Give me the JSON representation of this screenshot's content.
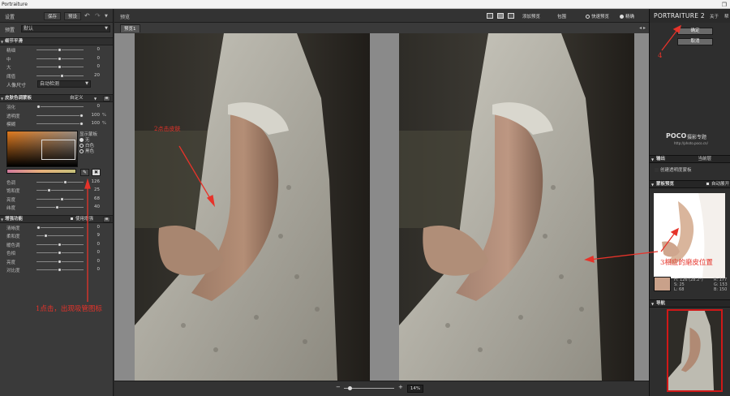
{
  "window": {
    "title": "Portraiture",
    "maximize_icon": "restore-icon"
  },
  "left_panel": {
    "header": {
      "settings": "设置",
      "save": "保存",
      "preset": "预设"
    },
    "preset_row": {
      "label": "预置",
      "value": "默认"
    },
    "detail": {
      "title": "细节平滑",
      "sliders": [
        {
          "label": "精细",
          "value": "0",
          "pos": 0.5
        },
        {
          "label": "中",
          "value": "0",
          "pos": 0.5
        },
        {
          "label": "大",
          "value": "0",
          "pos": 0.5
        },
        {
          "label": "阈值",
          "value": "20",
          "pos": 0.55
        }
      ],
      "portrait_size": {
        "label": "人像尺寸",
        "value": "自动检测"
      }
    },
    "skin_mask": {
      "title": "皮肤色调蒙板",
      "mode": "自定义",
      "sliders": [
        {
          "label": "羽化",
          "value": "0",
          "unit": "",
          "pos": 0.05
        },
        {
          "label": "透明度",
          "value": "100",
          "unit": "%",
          "pos": 0.97
        },
        {
          "label": "模糊",
          "value": "100",
          "unit": "%",
          "pos": 0.97
        }
      ],
      "mask_options": {
        "label": "显示蒙板",
        "options": [
          "无",
          "白色",
          "黑色"
        ],
        "selected": 0
      },
      "color_sliders": [
        {
          "label": "色调",
          "value": "126",
          "pos": 0.62
        },
        {
          "label": "饱和度",
          "value": "25",
          "pos": 0.28
        },
        {
          "label": "亮度",
          "value": "68",
          "pos": 0.55
        },
        {
          "label": "纬度",
          "value": "40",
          "pos": 0.45
        }
      ]
    },
    "enhance": {
      "title": "增强功能",
      "use_enhance": "使用增强",
      "sliders": [
        {
          "label": "清晰度",
          "value": "0",
          "pos": 0.05
        },
        {
          "label": "柔和度",
          "value": "9",
          "pos": 0.2
        },
        {
          "label": "暖色调",
          "value": "0",
          "pos": 0.5
        },
        {
          "label": "色相",
          "value": "0",
          "pos": 0.5
        },
        {
          "label": "亮度",
          "value": "0",
          "pos": 0.5
        },
        {
          "label": "对比度",
          "value": "0",
          "pos": 0.5
        }
      ]
    }
  },
  "center": {
    "title": "预览",
    "toolbar": {
      "add_preview": "添加预览",
      "compare": "包围",
      "quick_preview": "快速预览",
      "fine": "精确"
    },
    "tab": "预览1",
    "zoom": "14%"
  },
  "right_panel": {
    "brand": "PORTRAITURE 2",
    "about": "关于",
    "help": "帮",
    "ok": "确定",
    "cancel": "取消",
    "poco": {
      "name": "POCO",
      "subtitle": "摄影专题",
      "url": "http://photo.poco.cn/"
    },
    "output": {
      "title": "输出",
      "value": "当前层",
      "checkbox": "创建透明度蒙板"
    },
    "mask_preview": {
      "title": "蒙板预览",
      "auto_expand": "自动展开"
    },
    "readout": {
      "hsl": [
        "H: 126 (28.2°)",
        "S:  25",
        "L:  68"
      ],
      "rgb": [
        "R: 177",
        "G: 153",
        "B: 150"
      ]
    },
    "navigator": "导航"
  },
  "annotations": {
    "a1": "1点击，出现吸管图标",
    "a2": "2点击皮肤",
    "a3": "3相应的磨皮位置",
    "a4": "4"
  },
  "colors": {
    "accent_red": "#e6332a",
    "panel": "#3a3a3a",
    "skin_sample": "#c9a18a"
  }
}
